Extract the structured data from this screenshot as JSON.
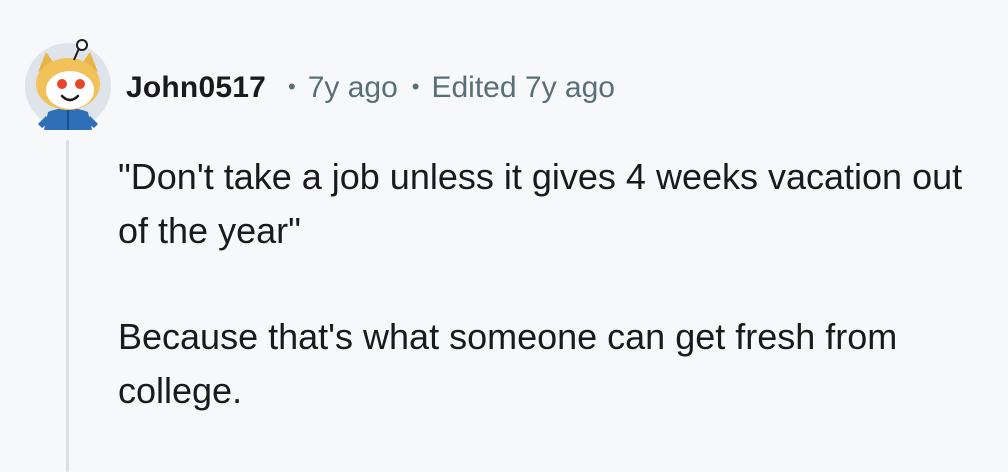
{
  "comment": {
    "author": "John0517",
    "age": "7y ago",
    "separator": "•",
    "edited": "Edited 7y ago",
    "avatar_icon": "snoo-avatar-icon",
    "paragraphs": [
      "\"Don't take a job unless it gives 4 weeks vacation out of the year\"",
      "Because that's what someone can get fresh from college."
    ]
  },
  "colors": {
    "background": "#f7f8fa",
    "text": "#1a1a1b",
    "meta": "#576f76",
    "thread_line": "#d9dee3"
  }
}
